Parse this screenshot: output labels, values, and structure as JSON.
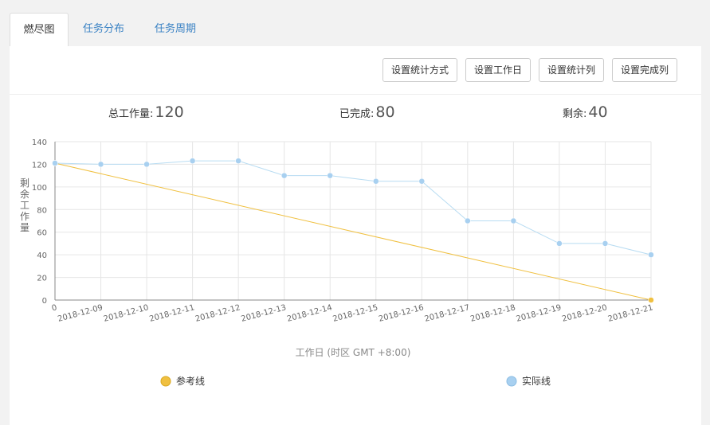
{
  "tabs": [
    {
      "label": "燃尽图",
      "active": true
    },
    {
      "label": "任务分布",
      "active": false
    },
    {
      "label": "任务周期",
      "active": false
    }
  ],
  "toolbar": {
    "stat_method": "设置统计方式",
    "workdays": "设置工作日",
    "stat_column": "设置统计列",
    "done_column": "设置完成列"
  },
  "stats": {
    "total_label": "总工作量:",
    "total_value": "120",
    "done_label": "已完成:",
    "done_value": "80",
    "remain_label": "剩余:",
    "remain_value": "40"
  },
  "colors": {
    "reference": "#f0c040",
    "actual": "#a8d0f0",
    "actual_line": "#b8dcf2",
    "tab_link": "#3a82c4"
  },
  "chart_data": {
    "type": "line",
    "ylabel": "剩余工作量",
    "xlabel": "工作日 (时区 GMT +8:00)",
    "categories": [
      "0",
      "2018-12-09",
      "2018-12-10",
      "2018-12-11",
      "2018-12-12",
      "2018-12-13",
      "2018-12-14",
      "2018-12-15",
      "2018-12-16",
      "2018-12-17",
      "2018-12-18",
      "2018-12-19",
      "2018-12-20",
      "2018-12-21"
    ],
    "ylim": [
      0,
      140
    ],
    "yticks": [
      0,
      20,
      40,
      60,
      80,
      100,
      120,
      140
    ],
    "grid": true,
    "legend": "bottom",
    "series": [
      {
        "name": "参考线",
        "color": "#f0c040",
        "values": [
          121,
          null,
          null,
          null,
          null,
          null,
          null,
          null,
          null,
          null,
          null,
          null,
          null,
          0
        ]
      },
      {
        "name": "实际线",
        "color": "#a8d0f0",
        "values": [
          121,
          120,
          120,
          123,
          123,
          110,
          110,
          105,
          105,
          70,
          70,
          50,
          50,
          40
        ]
      }
    ]
  }
}
